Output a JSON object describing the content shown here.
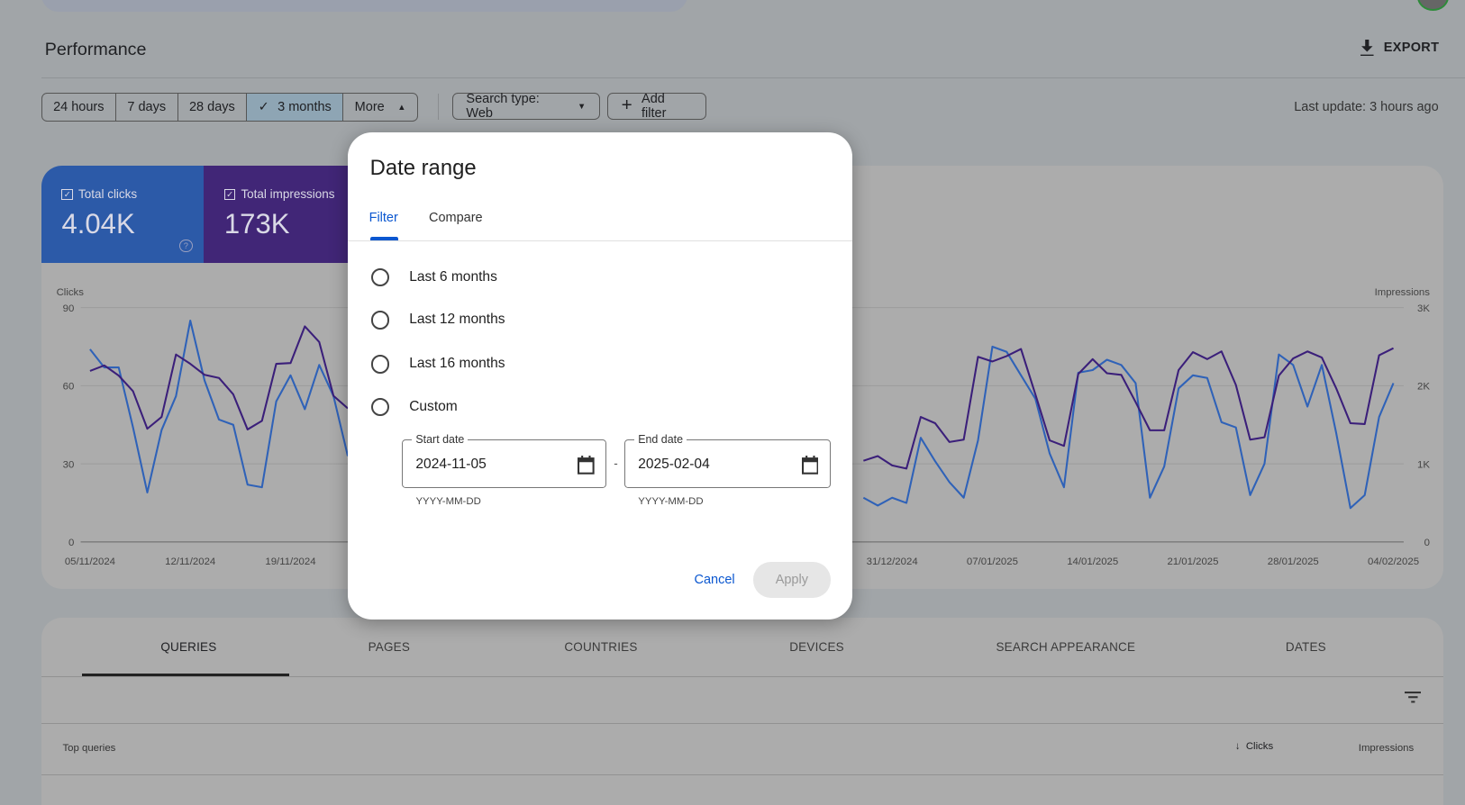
{
  "header": {
    "title": "Performance",
    "export_label": "EXPORT",
    "last_update": "Last update: 3 hours ago"
  },
  "filters": {
    "ranges": [
      {
        "label": "24 hours",
        "selected": false
      },
      {
        "label": "7 days",
        "selected": false
      },
      {
        "label": "28 days",
        "selected": false
      },
      {
        "label": "3 months",
        "selected": true
      },
      {
        "label": "More",
        "selected": false
      }
    ],
    "search_type": "Search type: Web",
    "add_filter": "Add filter"
  },
  "metrics": [
    {
      "label": "Total clicks",
      "value": "4.04K",
      "checked": true,
      "color": "#2c5aa8"
    },
    {
      "label": "Total impressions",
      "value": "173K",
      "checked": true,
      "color": "#412677"
    }
  ],
  "chart_data": {
    "type": "line",
    "left_axis": {
      "label": "Clicks",
      "ticks": [
        "0",
        "30",
        "60",
        "90"
      ],
      "range": [
        0,
        90
      ]
    },
    "right_axis": {
      "label": "Impressions",
      "ticks": [
        "0",
        "1K",
        "2K",
        "3K"
      ],
      "range": [
        0,
        3000
      ]
    },
    "x_tick_labels": [
      "05/11/2024",
      "12/11/2024",
      "19/11/2024",
      "31/12/2024",
      "07/01/2025",
      "14/01/2025",
      "21/01/2025",
      "28/01/2025",
      "04/02/2025"
    ],
    "x_range": [
      "2024-11-05",
      "2025-02-04"
    ],
    "grid": true,
    "series": [
      {
        "name": "Clicks",
        "axis": "left",
        "color": "#2f62b8",
        "values": [
          74,
          67,
          67,
          44,
          19,
          43,
          56,
          85,
          62,
          47,
          45,
          22,
          21,
          54,
          64,
          51,
          68,
          56,
          33,
          null,
          null,
          null,
          null,
          null,
          null,
          null,
          null,
          null,
          null,
          null,
          null,
          null,
          null,
          null,
          null,
          null,
          null,
          null,
          null,
          null,
          null,
          null,
          null,
          null,
          null,
          null,
          null,
          null,
          null,
          null,
          null,
          null,
          null,
          null,
          17,
          14,
          17,
          15,
          40,
          31,
          23,
          17,
          39,
          75,
          73,
          64,
          55,
          34,
          21,
          65,
          66,
          70,
          68,
          61,
          17,
          29,
          59,
          64,
          63,
          46,
          44,
          18,
          30,
          72,
          68,
          52,
          68,
          42,
          13,
          18,
          48,
          61
        ]
      },
      {
        "name": "Impressions",
        "axis": "right",
        "color": "#3b1f7a",
        "values": [
          2190,
          2260,
          2130,
          1930,
          1450,
          1600,
          2400,
          2280,
          2140,
          2100,
          1890,
          1440,
          1550,
          2280,
          2290,
          2760,
          2560,
          1870,
          1710,
          null,
          null,
          null,
          null,
          null,
          null,
          null,
          null,
          null,
          null,
          null,
          null,
          null,
          null,
          null,
          null,
          null,
          null,
          null,
          null,
          null,
          null,
          null,
          null,
          null,
          null,
          null,
          null,
          null,
          null,
          null,
          null,
          null,
          null,
          null,
          1040,
          1100,
          980,
          940,
          1600,
          1520,
          1280,
          1310,
          2370,
          2310,
          2380,
          2470,
          1890,
          1300,
          1230,
          2150,
          2340,
          2160,
          2140,
          1790,
          1430,
          1430,
          2200,
          2430,
          2340,
          2440,
          2010,
          1310,
          1340,
          2130,
          2350,
          2440,
          2360,
          1970,
          1520,
          1510,
          2390,
          2480
        ]
      }
    ]
  },
  "table": {
    "tabs": [
      "QUERIES",
      "PAGES",
      "COUNTRIES",
      "DEVICES",
      "SEARCH APPEARANCE",
      "DATES"
    ],
    "active_tab": "QUERIES",
    "columns": {
      "query": "Top queries",
      "clicks": "Clicks",
      "impressions": "Impressions"
    }
  },
  "dialog": {
    "title": "Date range",
    "tabs": [
      "Filter",
      "Compare"
    ],
    "active_tab": "Filter",
    "options": [
      {
        "label": "Last 6 months",
        "selected": false
      },
      {
        "label": "Last 12 months",
        "selected": false
      },
      {
        "label": "Last 16 months",
        "selected": false
      },
      {
        "label": "Custom",
        "selected": false
      }
    ],
    "start_date": {
      "label": "Start date",
      "value": "2024-11-05",
      "hint": "YYYY-MM-DD"
    },
    "end_date": {
      "label": "End date",
      "value": "2025-02-04",
      "hint": "YYYY-MM-DD"
    },
    "separator": "-",
    "cancel": "Cancel",
    "apply": "Apply",
    "apply_enabled": false
  }
}
